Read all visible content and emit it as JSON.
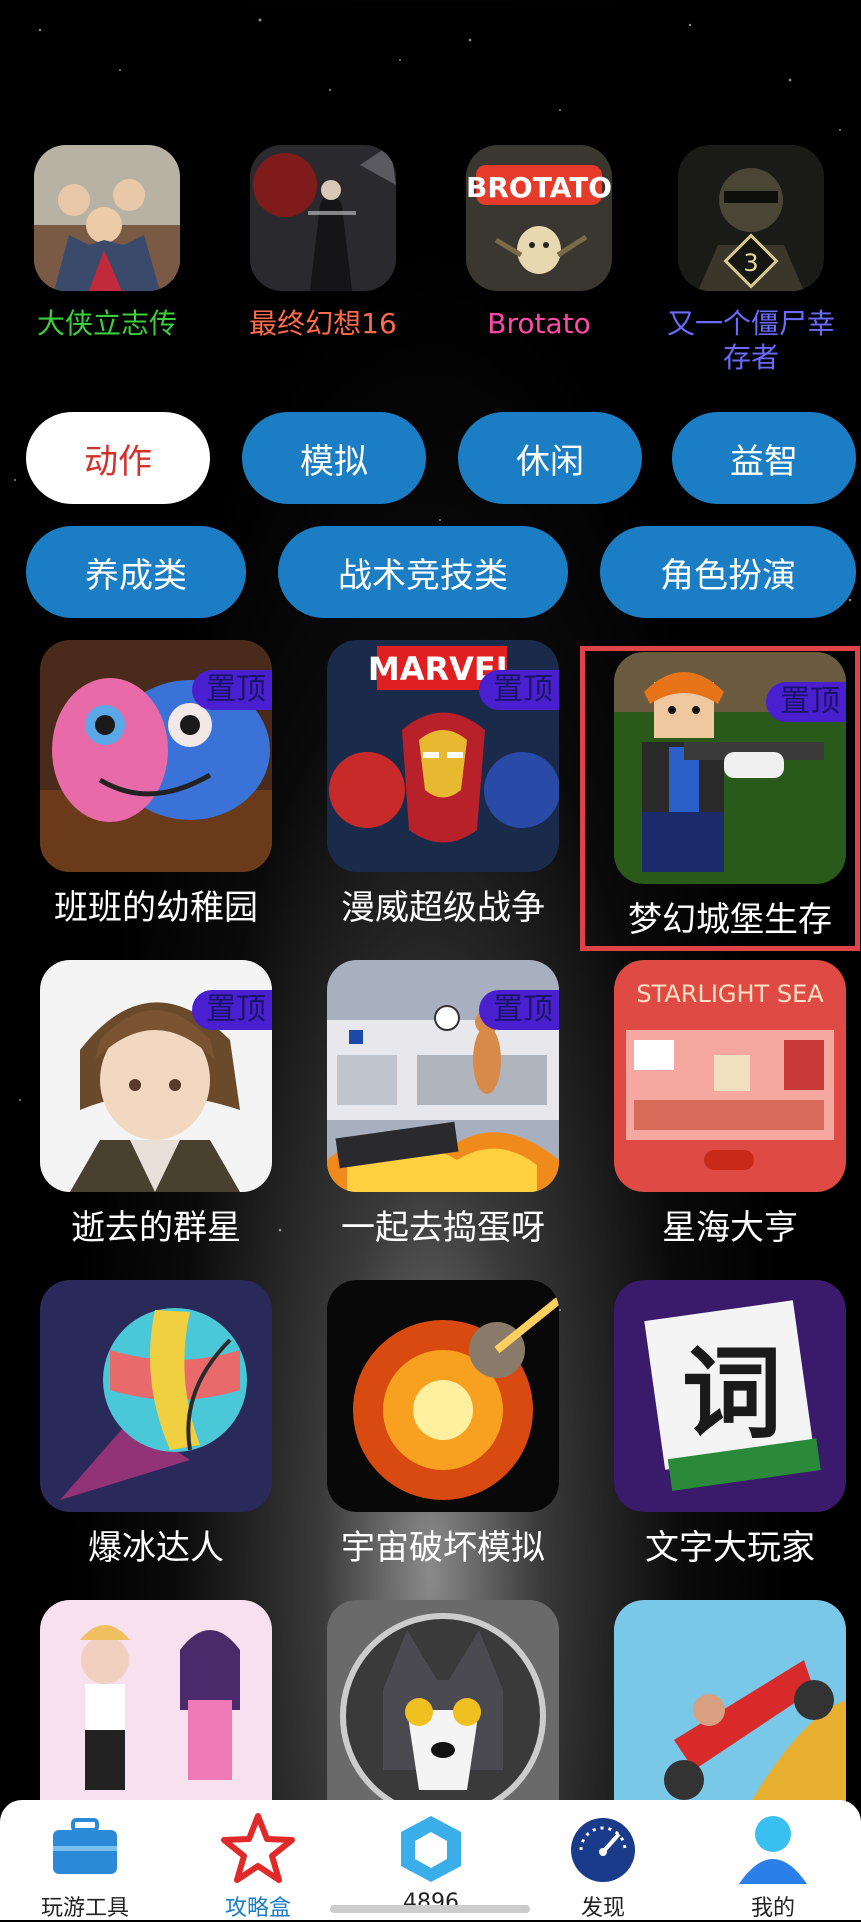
{
  "featured": [
    {
      "name": "大侠立志传",
      "color": "#3ccf3c"
    },
    {
      "name": "最终幻想16",
      "color": "#ff6a4a"
    },
    {
      "name": "Brotato",
      "color": "#ff4aa8"
    },
    {
      "name": "又一个僵尸幸存者",
      "color": "#6a6aff"
    }
  ],
  "categories": [
    "动作",
    "模拟",
    "休闲",
    "益智",
    "养成类",
    "战术竞技类",
    "角色扮演"
  ],
  "active_category": "动作",
  "pin_badge": "置顶",
  "brotato_logo": "BROTATO",
  "marvel_logo": "MARVEL",
  "starlight_logo": "STARLIGHT SEA",
  "word_tile": "词",
  "zombie_level": "3",
  "games": [
    {
      "name": "班班的幼稚园",
      "pinned": true
    },
    {
      "name": "漫威超级战争",
      "pinned": true
    },
    {
      "name": "梦幻城堡生存",
      "pinned": true,
      "highlighted": true
    },
    {
      "name": "逝去的群星",
      "pinned": true
    },
    {
      "name": "一起去捣蛋呀",
      "pinned": true
    },
    {
      "name": "星海大亨",
      "pinned": false
    },
    {
      "name": "爆冰达人",
      "pinned": false
    },
    {
      "name": "宇宙破坏模拟",
      "pinned": false
    },
    {
      "name": "文字大玩家",
      "pinned": false
    },
    {
      "name": "",
      "pinned": false
    },
    {
      "name": "",
      "pinned": false
    },
    {
      "name": "",
      "pinned": false
    }
  ],
  "nav": [
    {
      "label": "玩游工具",
      "icon": "toolbox-icon"
    },
    {
      "label": "攻略盒",
      "icon": "star-icon",
      "active": true
    },
    {
      "label": "4896",
      "icon": "cube-icon"
    },
    {
      "label": "发现",
      "icon": "speedometer-icon"
    },
    {
      "label": "我的",
      "icon": "user-icon"
    }
  ],
  "colors": {
    "accent": "#1b7ec4",
    "active_text": "#d2322b",
    "badge": "#4a1fcf",
    "highlight_border": "#e0424a"
  }
}
